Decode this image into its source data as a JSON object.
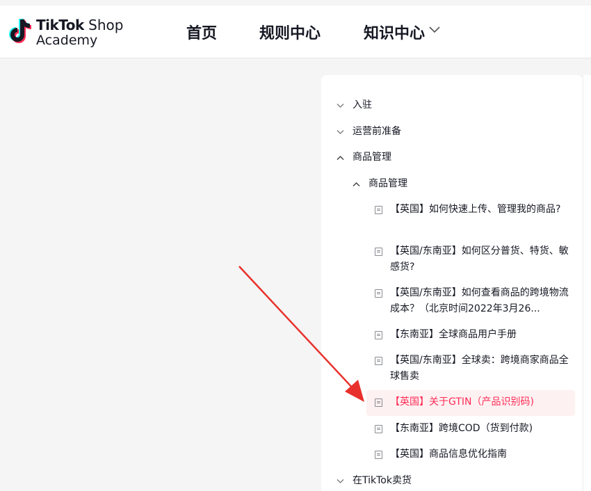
{
  "header": {
    "brand_line1_bold": "TikTok",
    "brand_line1_rest": " Shop",
    "brand_line2": "Academy",
    "nav": [
      "首页",
      "规则中心",
      "知识中心"
    ]
  },
  "sidebar": {
    "top_items": [
      "入驻",
      "运营前准备",
      "商品管理"
    ],
    "sub_section": "商品管理",
    "leaves": [
      "【英国】如何快速上传、管理我的商品?",
      "【英国/东南亚】如何区分普货、特货、敏感货?",
      "【英国/东南亚】如何查看商品的跨境物流成本？（北京时间2022年3月26...",
      "【东南亚】全球商品用户手册",
      "【英国/东南亚】全球卖：跨境商家商品全球售卖",
      "【英国】关于GTIN（产品识别码)",
      "【东南亚】跨境COD（货到付款)",
      "【英国】商品信息优化指南"
    ],
    "bottom_item": "在TikTok卖货",
    "active_index": 5
  },
  "colors": {
    "accent": "#fe2c55",
    "arrow": "#e8312c",
    "active_bg": "#fef1f2"
  }
}
